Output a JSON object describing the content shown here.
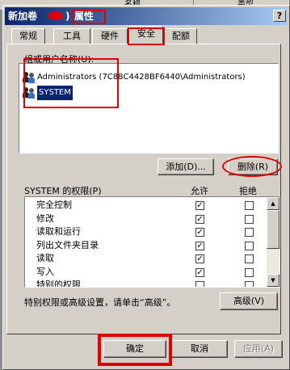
{
  "background": {
    "columns": [
      "名称",
      "类型"
    ]
  },
  "window": {
    "title": "新加卷",
    "title_paren": ")",
    "title_suffix": "属性",
    "help": "?"
  },
  "tabs": [
    "常规",
    "工具",
    "硬件",
    "安全",
    "配额"
  ],
  "active_tab": "安全",
  "users_section": {
    "label": "组或用户名称(U):",
    "items": [
      {
        "name": "Administrators (7C88C4428BF6440\\Administrators)",
        "selected": false
      },
      {
        "name": "SYSTEM",
        "selected": true
      }
    ]
  },
  "buttons": {
    "add": "添加(D)...",
    "remove": "删除(R)",
    "advanced": "高级(V)",
    "ok": "确定",
    "cancel": "取消",
    "apply": "应用(A)"
  },
  "permissions": {
    "label": "SYSTEM 的权限(P)",
    "allow_header": "允许",
    "deny_header": "拒绝",
    "rows": [
      {
        "name": "完全控制",
        "allow": true,
        "deny": false
      },
      {
        "name": "修改",
        "allow": true,
        "deny": false
      },
      {
        "name": "读取和运行",
        "allow": true,
        "deny": false
      },
      {
        "name": "列出文件夹目录",
        "allow": true,
        "deny": false
      },
      {
        "name": "读取",
        "allow": true,
        "deny": false
      },
      {
        "name": "写入",
        "allow": true,
        "deny": false
      },
      {
        "name": "特别的权限",
        "allow": false,
        "deny": false
      }
    ]
  },
  "advanced_note": "特别权限或高级设置，请单击“高级”。",
  "colors": {
    "highlight": "#e00000",
    "selection": "#0a246a",
    "title_bar": "#0a246a"
  }
}
